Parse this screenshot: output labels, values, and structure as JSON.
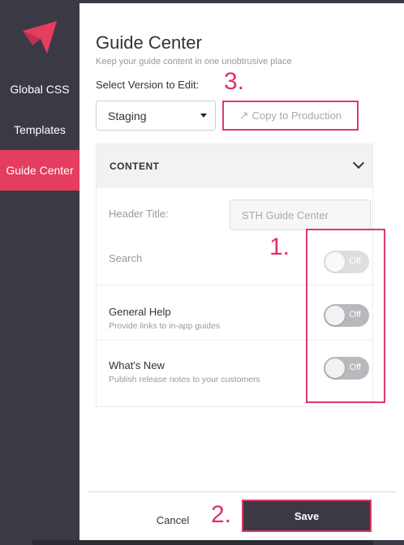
{
  "sidebar": {
    "logo_icon": "pendo-logo-icon",
    "items": [
      {
        "label": "Global CSS",
        "active": false
      },
      {
        "label": "Templates",
        "active": false
      },
      {
        "label": "Guide Center",
        "active": true
      }
    ]
  },
  "panel": {
    "title": "Guide Center",
    "subtitle": "Keep your guide content in one unobtrusive place",
    "version_label": "Select Version to Edit:",
    "version_select": {
      "value": "Staging"
    },
    "copy_button": {
      "label": "Copy to Production",
      "icon": "arrow-up-right-icon"
    },
    "section": {
      "header": "CONTENT",
      "header_title_label": "Header Title:",
      "header_title_value": "STH Guide Center",
      "rows": [
        {
          "title": "Search",
          "desc": "",
          "toggle": "Off"
        },
        {
          "title": "General Help",
          "desc": "Provide links to in-app guides",
          "toggle": "Off"
        },
        {
          "title": "What's New",
          "desc": "Publish release notes to your customers",
          "toggle": "Off"
        }
      ]
    },
    "footer": {
      "cancel_label": "Cancel",
      "save_label": "Save"
    }
  },
  "annotations": {
    "one": "1.",
    "two": "2.",
    "three": "3."
  },
  "colors": {
    "accent": "#e53d5f",
    "dark": "#3b3a44",
    "annotation": "#dc3a6a"
  }
}
